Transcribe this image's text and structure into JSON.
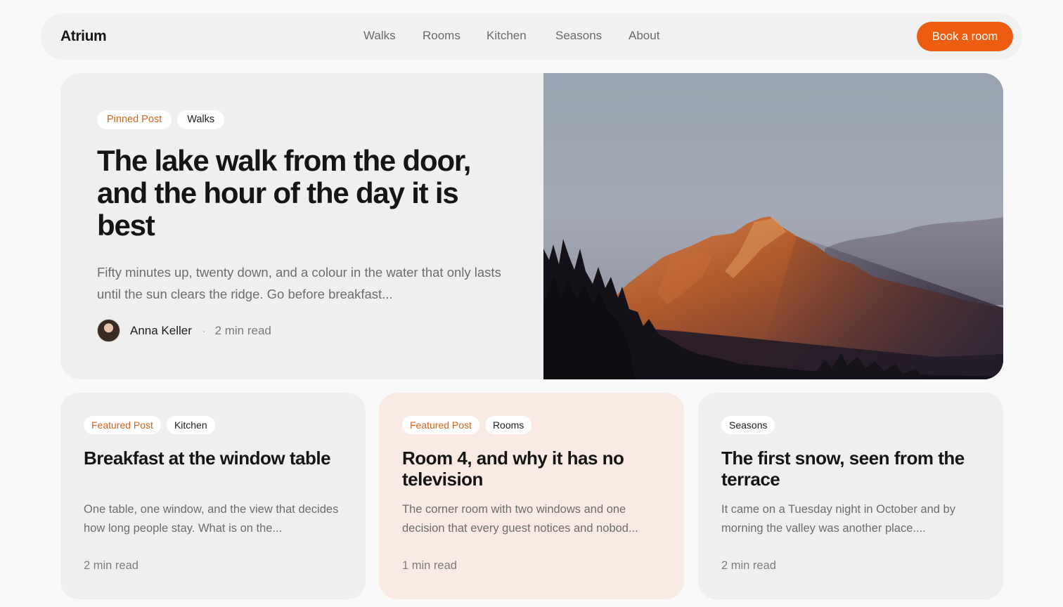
{
  "nav": {
    "logo": "Atrium",
    "links": [
      "Walks",
      "Rooms",
      "Kitchen",
      "Seasons",
      "About"
    ],
    "cta": "Book a room"
  },
  "hero": {
    "tags": [
      "Pinned Post",
      "Walks"
    ],
    "title": "The lake walk from the door, and the hour of the day it is best",
    "excerpt": "Fifty minutes up, twenty down, and a colour in the water that only lasts until the sun clears the ridge. Go before breakfast...",
    "author": "Anna Keller",
    "separator": "·",
    "read_time": "2 min read",
    "image": "mountain-peak-at-sunrise"
  },
  "cards": [
    {
      "tags": [
        "Featured Post",
        "Kitchen"
      ],
      "title": "Breakfast at the window table",
      "excerpt": "One table, one window, and the view that decides how long people stay. What is on the...",
      "read_time": "2 min read"
    },
    {
      "tags": [
        "Featured Post",
        "Rooms"
      ],
      "title": "Room 4, and why it has no television",
      "excerpt": "The corner room with two windows and one decision that every guest notices and nobod...",
      "read_time": "1 min read"
    },
    {
      "tags": [
        "Seasons"
      ],
      "title": "The first snow, seen from the terrace",
      "excerpt": "It came on a Tuesday night in October and by morning the valley was another place....",
      "read_time": "2 min read"
    }
  ],
  "colors": {
    "accent": "#ec5d12",
    "tag_accent_text": "#d46420",
    "card_bg": "#efefef",
    "card_peach_bg": "#f9ebe3"
  }
}
